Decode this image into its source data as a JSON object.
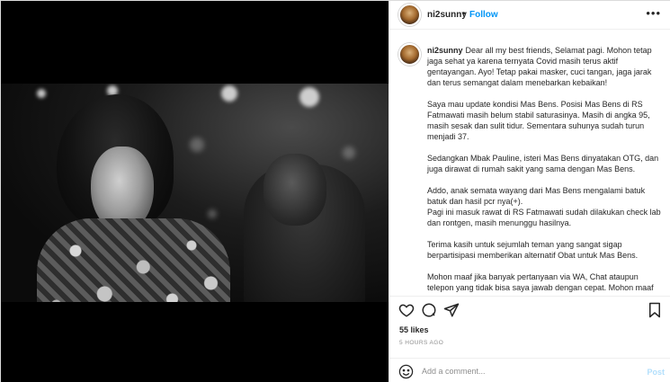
{
  "colors": {
    "accent": "#0095f6",
    "post_disabled": "#b2dffc",
    "text": "#262626",
    "muted": "#8e8e8e",
    "border": "#efefef"
  },
  "post": {
    "username": "ni2sunny",
    "separator": "•",
    "follow_label": "Follow",
    "more_icon": "more-options-icon"
  },
  "caption": {
    "username": "ni2sunny",
    "paragraphs": [
      "Dear all my best friends, Selamat pagi. Mohon tetap jaga sehat ya karena ternyata Covid masih terus aktif gentayangan. Ayo! Tetap pakai masker, cuci tangan, jaga jarak dan terus semangat dalam menebarkan kebaikan!",
      "Saya mau update kondisi Mas Bens. Posisi Mas Bens di RS Fatmawati masih belum stabil saturasinya. Masih di angka 95, masih sesak dan sulit tidur. Sementara suhunya sudah turun menjadi 37.",
      "Sedangkan Mbak Pauline, isteri Mas Bens dinyatakan OTG, dan juga dirawat di rumah sakit yang sama dengan Mas Bens.",
      "Addo, anak semata wayang dari Mas Bens mengalami batuk batuk dan hasil pcr nya(+).",
      "Pagi ini masuk rawat di RS Fatmawati sudah dilakukan check lab dan rontgen, masih menunggu hasilnya.",
      "Terima kasih untuk sejumlah teman yang sangat sigap berpartisipasi memberikan alternatif Obat untuk Mas Bens.",
      "Mohon maaf jika banyak pertanyaan via WA, Chat ataupun telepon yang tidak bisa saya jawab dengan cepat. Mohon maaf juga untuk tidak melakukan kunjungan ke Fatmawati."
    ]
  },
  "stats": {
    "likes": "55 likes",
    "time": "5 HOURS AGO"
  },
  "comment": {
    "placeholder": "Add a comment...",
    "post_label": "Post"
  },
  "icons": {
    "like": "heart-icon",
    "comment": "comment-icon",
    "share": "share-icon",
    "save": "bookmark-icon",
    "emoji": "emoji-icon"
  }
}
